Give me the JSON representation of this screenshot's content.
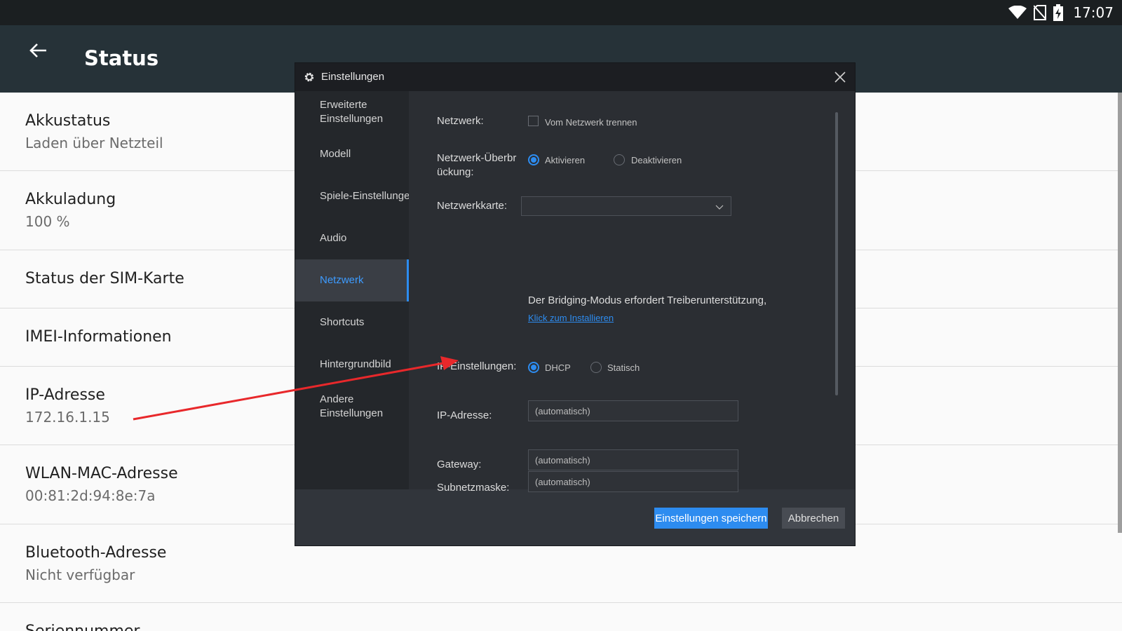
{
  "statusbar": {
    "time": "17:07",
    "icons": [
      "wifi-icon",
      "no-sim-icon",
      "battery-charging-icon"
    ]
  },
  "appbar": {
    "title": "Status",
    "back_icon": "arrow-left-icon"
  },
  "list": {
    "items": [
      {
        "title": "Akkustatus",
        "subtitle": "Laden über Netzteil"
      },
      {
        "title": "Akkuladung",
        "subtitle": "100 %"
      },
      {
        "title": "Status der SIM-Karte"
      },
      {
        "title": "IMEI-Informationen"
      },
      {
        "title": "IP-Adresse",
        "subtitle": "172.16.1.15"
      },
      {
        "title": "WLAN-MAC-Adresse",
        "subtitle": "00:81:2d:94:8e:7a"
      },
      {
        "title": "Bluetooth-Adresse",
        "subtitle": "Nicht verfügbar"
      },
      {
        "title": "Seriennummer"
      }
    ]
  },
  "dialog": {
    "title": "Einstellungen",
    "nav": [
      "Erweiterte Einstellungen",
      "Modell",
      "Spiele-Einstellungen",
      "Audio",
      "Netzwerk",
      "Shortcuts",
      "Hintergrundbild",
      "Andere Einstellungen"
    ],
    "active_nav": "Netzwerk",
    "content": {
      "network_label": "Netzwerk:",
      "disconnect_label": "Vom Netzwerk trennen",
      "bridge_label": "Netzwerk-Überbrückung:",
      "bridge_on": "Aktivieren",
      "bridge_off": "Deaktivieren",
      "card_label": "Netzwerkkarte:",
      "card_value": "",
      "bridge_note": "Der Bridging-Modus erfordert Treiberunterstützung,",
      "install_link": "Klick zum Installieren",
      "ip_settings_label": "IP-Einstellungen:",
      "dhcp": "DHCP",
      "static": "Statisch",
      "ip_label": "IP-Adresse:",
      "ip_placeholder": "(automatisch)",
      "gateway_label": "Gateway:",
      "gateway_placeholder": "(automatisch)",
      "subnet_label": "Subnetzmaske:",
      "subnet_placeholder": "(automatisch)"
    },
    "footer": {
      "save": "Einstellungen speichern",
      "cancel": "Abbrechen"
    }
  },
  "colors": {
    "accent": "#2d8cf0",
    "appbar": "#263238",
    "annotation": "#e8282b"
  }
}
